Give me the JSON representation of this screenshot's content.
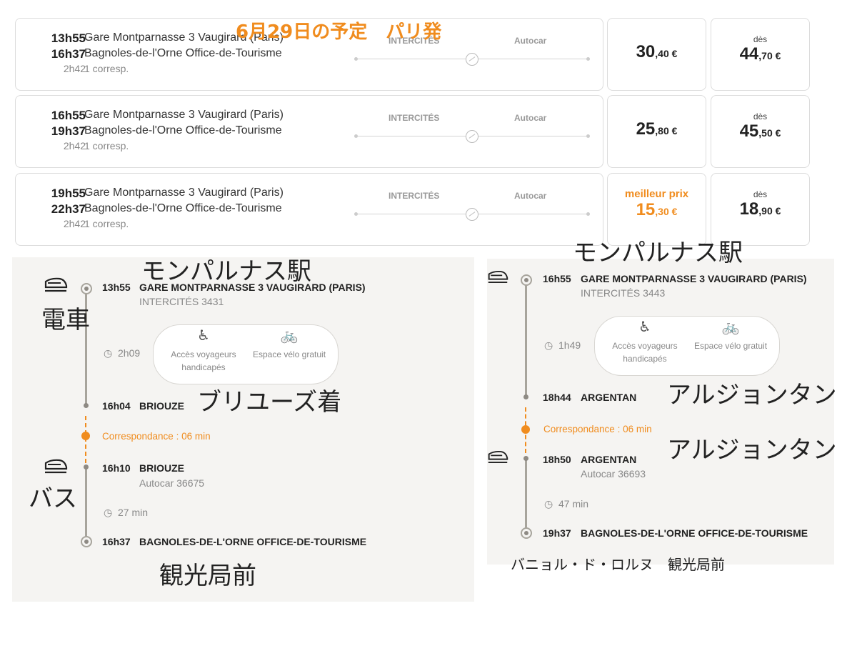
{
  "overlay_title": "6月29日の予定　パリ発",
  "trips": [
    {
      "dep": "13h55",
      "arr": "16h37",
      "duration": "2h42",
      "from": "Gare Montparnasse 3 Vaugirard (Paris)",
      "to": "Bagnoles-de-l'Orne Office-de-Tourisme",
      "corresp": "1 corresp.",
      "mode1": "INTERCITÉS",
      "mode2": "Autocar",
      "price1": {
        "int": "30",
        "dec": ",40 €"
      },
      "price2": {
        "label": "dès",
        "int": "44",
        "dec": ",70 €"
      }
    },
    {
      "dep": "16h55",
      "arr": "19h37",
      "duration": "2h42",
      "from": "Gare Montparnasse 3 Vaugirard (Paris)",
      "to": "Bagnoles-de-l'Orne Office-de-Tourisme",
      "corresp": "1 corresp.",
      "mode1": "INTERCITÉS",
      "mode2": "Autocar",
      "price1": {
        "int": "25",
        "dec": ",80 €"
      },
      "price2": {
        "label": "dès",
        "int": "45",
        "dec": ",50 €"
      }
    },
    {
      "dep": "19h55",
      "arr": "22h37",
      "duration": "2h42",
      "from": "Gare Montparnasse 3 Vaugirard (Paris)",
      "to": "Bagnoles-de-l'Orne Office-de-Tourisme",
      "corresp": "1 corresp.",
      "mode1": "INTERCITÉS",
      "mode2": "Autocar",
      "price1": {
        "best": "meilleur prix",
        "int": "15",
        "dec": ",30 €"
      },
      "price2": {
        "label": "dès",
        "int": "18",
        "dec": ",90 €"
      }
    }
  ],
  "left_detail": {
    "dep_time": "13h55",
    "dep_station": "GARE MONTPARNASSE 3 VAUGIRARD (PARIS)",
    "train": "INTERCITÉS 3431",
    "leg1_duration": "2h09",
    "feature1": "Accès voyageurs handicapés",
    "feature2": "Espace vélo gratuit",
    "arr1_time": "16h04",
    "arr1_station": "BRIOUZE",
    "correspondance": "Correspondance : 06 min",
    "dep2_time": "16h10",
    "dep2_station": "BRIOUZE",
    "bus": "Autocar 36675",
    "leg2_duration": "27 min",
    "final_time": "16h37",
    "final_station": "BAGNOLES-DE-L'ORNE OFFICE-DE-TOURISME",
    "notes": {
      "top": "モンパルナス駅",
      "train": "電車",
      "transfer": "ブリユーズ着",
      "bus": "バス",
      "bottom": "観光局前"
    }
  },
  "right_detail": {
    "dep_time": "16h55",
    "dep_station": "GARE MONTPARNASSE 3 VAUGIRARD (PARIS)",
    "train": "INTERCITÉS 3443",
    "leg1_duration": "1h49",
    "feature1": "Accès voyageurs handicapés",
    "feature2": "Espace vélo gratuit",
    "arr1_time": "18h44",
    "arr1_station": "ARGENTAN",
    "correspondance": "Correspondance : 06 min",
    "dep2_time": "18h50",
    "dep2_station": "ARGENTAN",
    "bus": "Autocar 36693",
    "leg2_duration": "47 min",
    "final_time": "19h37",
    "final_station": "BAGNOLES-DE-L'ORNE OFFICE-DE-TOURISME",
    "notes": {
      "top": "モンパルナス駅",
      "arr": "アルジョンタン",
      "dep": "アルジョンタン",
      "bottom": "バニョル・ド・ロルヌ　観光局前"
    }
  }
}
